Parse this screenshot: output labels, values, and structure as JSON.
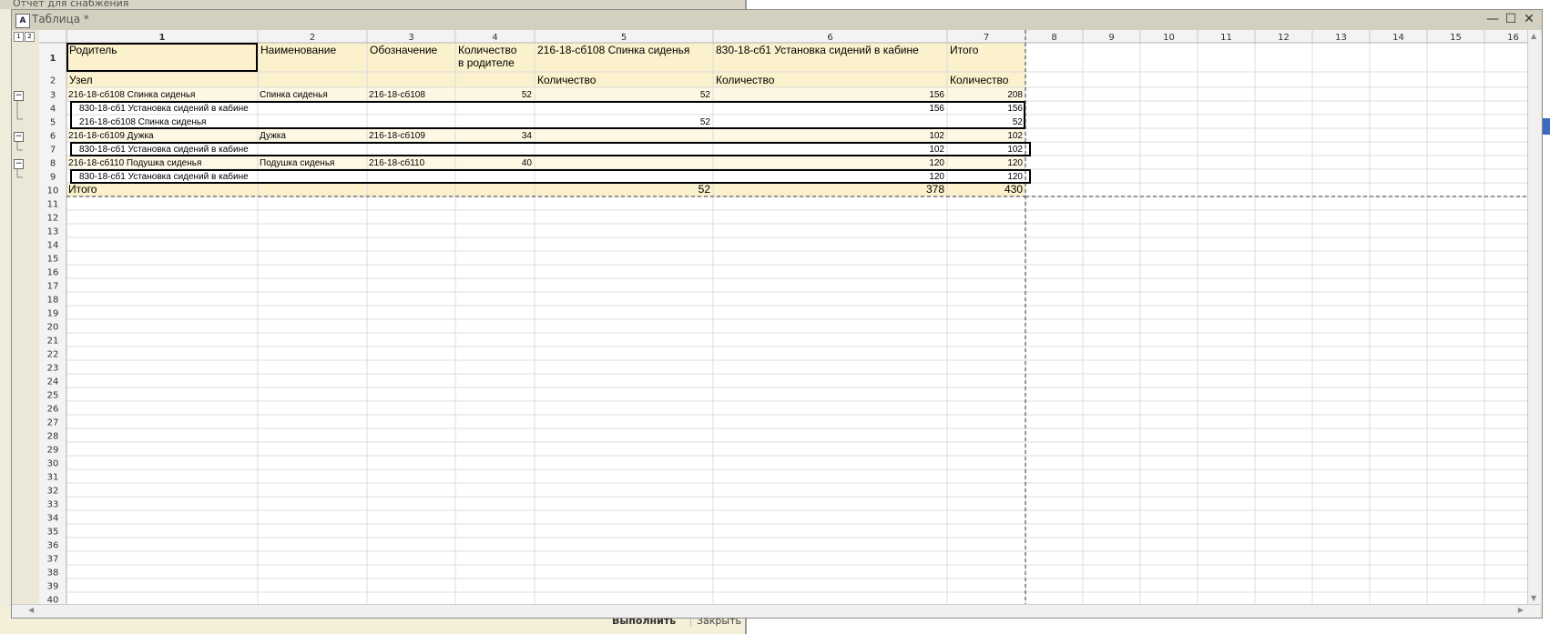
{
  "background_window": {
    "title": "Отчет для снабжения",
    "run_button": "Выполнить",
    "close_button": "Закрыть"
  },
  "window": {
    "title": "Таблица *",
    "title_icon": "spreadsheet-icon",
    "minimize": "minimize-icon",
    "maximize": "maximize-icon",
    "close": "close-icon"
  },
  "outline": {
    "levels": [
      "1",
      "2"
    ]
  },
  "grid": {
    "column_headers": [
      "1",
      "2",
      "3",
      "4",
      "5",
      "6",
      "7",
      "8",
      "9",
      "10",
      "11",
      "12",
      "13",
      "14",
      "15",
      "16"
    ],
    "row_count": 40,
    "header_row1": [
      "Родитель",
      "Наименование",
      "Обозначение",
      "Количество\nв родителе",
      "216-18-сб108 Спинка сиденья",
      "830-18-сб1 Установка сидений в кабине",
      "Итого"
    ],
    "header_row2": [
      "Узел",
      "",
      "",
      "",
      "Количество",
      "Количество",
      "Количество"
    ],
    "rows": [
      {
        "row": 3,
        "cells": [
          "216-18-сб108 Спинка сиденья",
          "Спинка сиденья",
          "216-18-сб108",
          "52",
          "52",
          "156",
          "208"
        ],
        "type": "group"
      },
      {
        "row": 4,
        "cells": [
          "830-18-сб1 Установка сидений в кабине",
          "",
          "",
          "",
          "",
          "156",
          "156"
        ],
        "type": "detail"
      },
      {
        "row": 5,
        "cells": [
          "216-18-сб108 Спинка сиденья",
          "",
          "",
          "",
          "52",
          "",
          "52"
        ],
        "type": "detail"
      },
      {
        "row": 6,
        "cells": [
          "216-18-сб109 Дужка",
          "Дужка",
          "216-18-сб109",
          "34",
          "",
          "102",
          "102"
        ],
        "type": "group"
      },
      {
        "row": 7,
        "cells": [
          "830-18-сб1 Установка сидений в кабине",
          "",
          "",
          "",
          "",
          "102",
          "102"
        ],
        "type": "detail"
      },
      {
        "row": 8,
        "cells": [
          "216-18-сб110 Подушка сиденья",
          "Подушка сиденья",
          "216-18-сб110",
          "40",
          "",
          "120",
          "120"
        ],
        "type": "group"
      },
      {
        "row": 9,
        "cells": [
          "830-18-сб1 Установка сидений в кабине",
          "",
          "",
          "",
          "",
          "120",
          "120"
        ],
        "type": "detail"
      },
      {
        "row": 10,
        "cells": [
          "Итого",
          "",
          "",
          "",
          "52",
          "378",
          "430"
        ],
        "type": "total"
      }
    ]
  },
  "colors": {
    "header_bg": "#fbf1cc",
    "group_bg": "#fdf7e4",
    "total_bg": "#fbf1cc",
    "grid_line": "#dcdcdc"
  }
}
